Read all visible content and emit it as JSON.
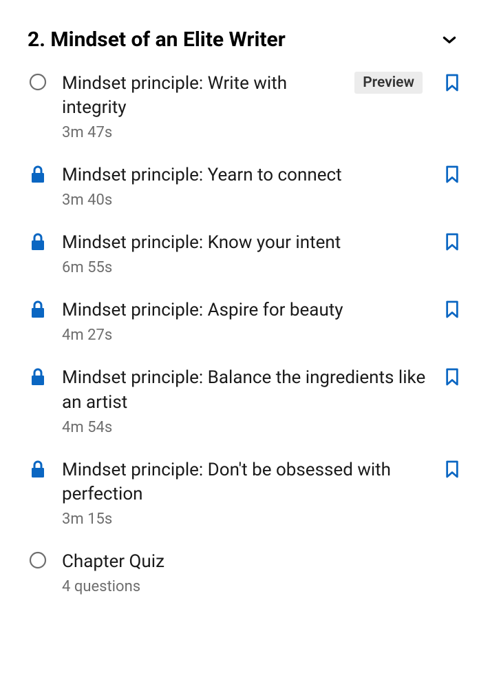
{
  "section": {
    "title": "2. Mindset of an Elite Writer"
  },
  "lessons": [
    {
      "title": "Mindset principle: Write with integrity",
      "meta": "3m 47s",
      "badge": "Preview"
    },
    {
      "title": "Mindset principle: Yearn to connect",
      "meta": "3m 40s"
    },
    {
      "title": "Mindset principle: Know your intent",
      "meta": "6m 55s"
    },
    {
      "title": "Mindset principle: Aspire for beauty",
      "meta": "4m 27s"
    },
    {
      "title": "Mindset principle: Balance the ingredients like an artist",
      "meta": "4m 54s"
    },
    {
      "title": "Mindset principle: Don't be obsessed with perfection",
      "meta": "3m 15s"
    }
  ],
  "quiz": {
    "title": "Chapter Quiz",
    "meta": "4 questions"
  },
  "colors": {
    "accent": "#0a66c2",
    "badgeBg": "#ececec",
    "muted": "#6e6e6e"
  }
}
